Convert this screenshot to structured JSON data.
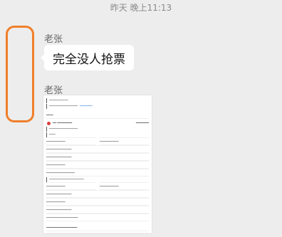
{
  "chat": {
    "timestamp": "昨天 晚上11:13",
    "messages": [
      {
        "sender": "老张",
        "text": "完全没人抢票"
      },
      {
        "sender": "老张"
      }
    ]
  },
  "colors": {
    "background": "#ededed",
    "highlight": "#f07f2b",
    "bubble": "#ffffff"
  }
}
